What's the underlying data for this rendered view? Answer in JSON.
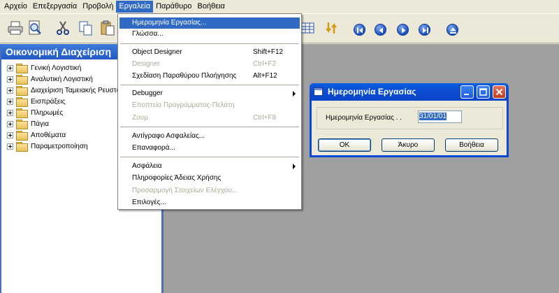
{
  "menubar": {
    "items": [
      "Αρχείο",
      "Επεξεργασία",
      "Προβολή",
      "Εργαλεία",
      "Παράθυρο",
      "Βοήθεια"
    ]
  },
  "toolbar": {
    "icons": [
      "print-icon",
      "print-preview-icon",
      "cut-icon",
      "copy-icon",
      "paste-icon",
      "table-icon",
      "refresh-icon",
      "first-record-icon",
      "previous-record-icon",
      "next-record-icon",
      "last-record-icon",
      "eject-icon"
    ]
  },
  "nav_pane": {
    "title": "Οικονομική Διαχείριση",
    "items": [
      "Γενική Λογιστική",
      "Αναλυτική Λογιστική",
      "Διαχείριση Ταμειακής Ρευστότητας",
      "Εισπράξεις",
      "Πληρωμές",
      "Πάγια",
      "Αποθέματα",
      "Παραμετροποίηση"
    ]
  },
  "tools_menu": {
    "items": [
      {
        "label": "Ημερομηνία Εργασίας...",
        "shortcut": ""
      },
      {
        "label": "Γλώσσα...",
        "shortcut": ""
      },
      {
        "label": "Object Designer",
        "shortcut": "Shift+F12"
      },
      {
        "label": "Designer",
        "shortcut": "Ctrl+F2"
      },
      {
        "label": "Σχεδίαση Παραθύρου Πλοήγησης",
        "shortcut": "Alt+F12"
      },
      {
        "label": "Debugger",
        "shortcut": ""
      },
      {
        "label": "Εποπτεία Προγράμματος-Πελάτη",
        "shortcut": ""
      },
      {
        "label": "Ζουμ",
        "shortcut": "Ctrl+F8"
      },
      {
        "label": "Αντίγραφο Ασφαλείας...",
        "shortcut": ""
      },
      {
        "label": "Επαναφορά...",
        "shortcut": ""
      },
      {
        "label": "Ασφάλεια",
        "shortcut": ""
      },
      {
        "label": "Πληροφορίες Άδειας Χρήσης",
        "shortcut": ""
      },
      {
        "label": "Προσαρμογή Στοιχείων Ελέγχου...",
        "shortcut": ""
      },
      {
        "label": "Επιλογές...",
        "shortcut": ""
      }
    ]
  },
  "dialog": {
    "title": "Ημερομηνία Εργασίας",
    "field_label": "Ημερομηνία Εργασίας  . .",
    "field_value": "31/01/01",
    "ok_label": "OK",
    "cancel_label": "Άκυρο",
    "help_label": "Βοήθεια"
  },
  "colors": {
    "accent": "#316ac5",
    "title_bar": "#0b4ed3",
    "workspace": "#a0a0a0"
  }
}
